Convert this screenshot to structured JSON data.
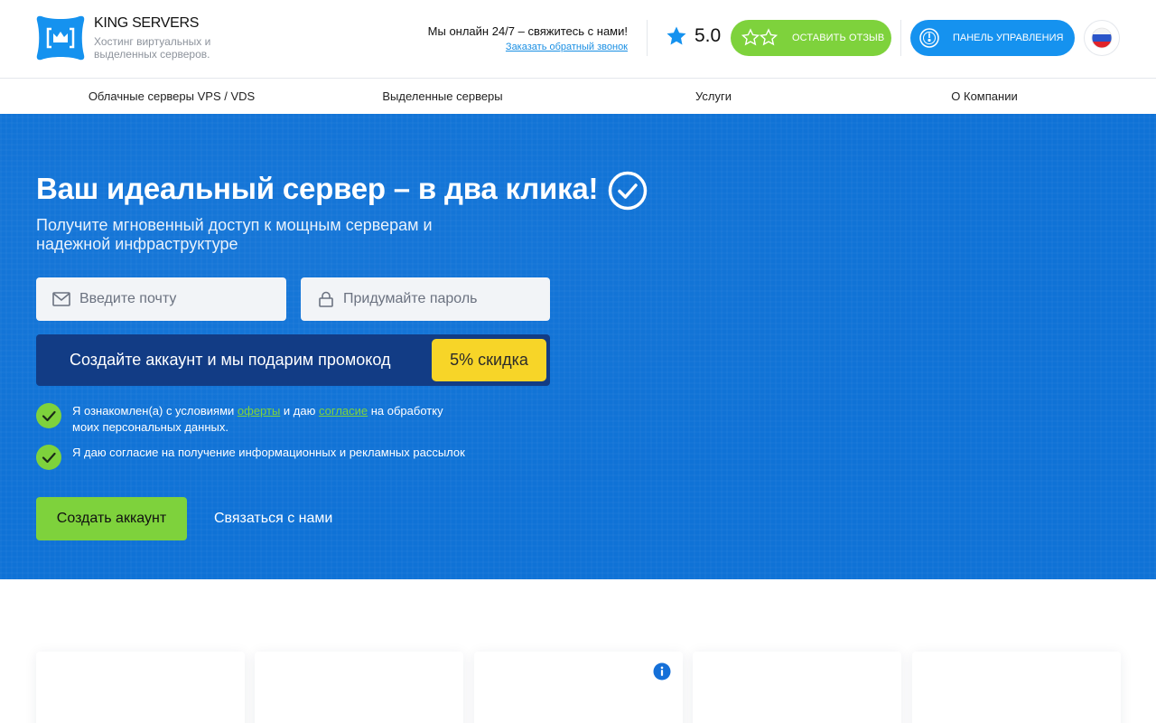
{
  "brand": {
    "name": "KING SERVERS",
    "tagline": "Хостинг виртуальных и выделенных серверов."
  },
  "header": {
    "online_text": "Мы онлайн 24/7 – свяжитесь с нами!",
    "callback_label": "Заказать обратный звонок",
    "rating": "5.0",
    "review_label": "ОСТАВИТЬ ОТЗЫВ",
    "panel_label": "ПАНЕЛЬ УПРАВЛЕНИЯ"
  },
  "nav": {
    "items": [
      {
        "label": "Облачные серверы VPS / VDS"
      },
      {
        "label": "Выделенные серверы"
      },
      {
        "label": "Услуги"
      },
      {
        "label": "О Компании"
      }
    ]
  },
  "hero": {
    "title": "Ваш идеальный сервер – в два клика!",
    "subtitle": "Получите мгновенный доступ к мощным серверам и надежной инфраструктуре",
    "email_placeholder": "Введите почту",
    "password_placeholder": "Придумайте пароль",
    "promo_text": "Создайте аккаунт и мы подарим промокод",
    "promo_badge": "5% скидка",
    "consent1": {
      "part1": "Я ознакомлен(а) с условиями ",
      "link1": "оферты",
      "part2": " и даю ",
      "link2": "согласие",
      "part3": " на обработку моих персональных данных."
    },
    "consent2": "Я даю согласие на получение информационных и рекламных рассылок",
    "create_label": "Создать аккаунт",
    "contact_label": "Связаться с нами"
  },
  "colors": {
    "hero_blue": "#0f72d6",
    "accent_green": "#7ed23c",
    "accent_blue": "#1592ef",
    "promo_dark": "#123c85",
    "badge_yellow": "#f7d528"
  },
  "icons": [
    "logo-crown-icon",
    "star-icon",
    "stars-outline-icon",
    "speedometer-icon",
    "russia-flag-icon",
    "check-circle-icon",
    "mail-icon",
    "lock-icon",
    "checkbox-checked-icon",
    "info-icon"
  ]
}
